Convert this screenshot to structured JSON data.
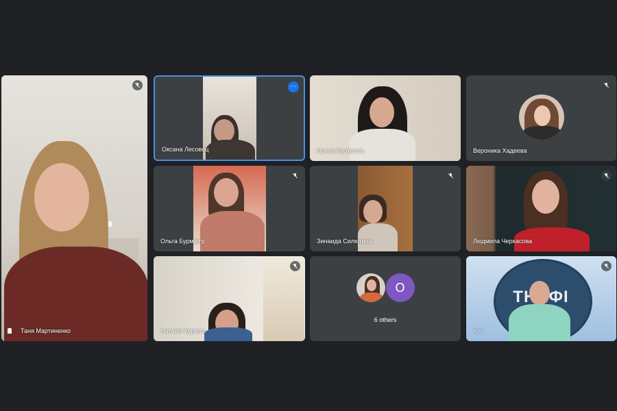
{
  "participants": [
    {
      "name": "Таня Мартиненко",
      "muted": true
    },
    {
      "name": "Оксана Лесовец",
      "active": true
    },
    {
      "name": "Ирина Крохмаль"
    },
    {
      "name": "Вероника Хадеева",
      "muted": true
    },
    {
      "name": "Ольга Бурмістр",
      "muted": true
    },
    {
      "name": "Зинаида Силютина",
      "muted": true
    },
    {
      "name": "Людмила Черкасова",
      "muted": true
    },
    {
      "name": "Наталія Курило",
      "muted": true
    },
    {
      "name": "You",
      "muted": true
    }
  ],
  "others": {
    "initial": "O",
    "label": "6 others"
  },
  "you_tile": {
    "background_text": "ТНПФІ"
  },
  "colors": {
    "background": "#202124",
    "tile": "#3c4043",
    "active_border": "#4a90e2",
    "more_button": "#1a73e8",
    "avatar_initial": "#7e57c2"
  },
  "icons": {
    "mute": "mic-off-icon",
    "more": "more-options-icon",
    "pin": "pin-icon"
  }
}
